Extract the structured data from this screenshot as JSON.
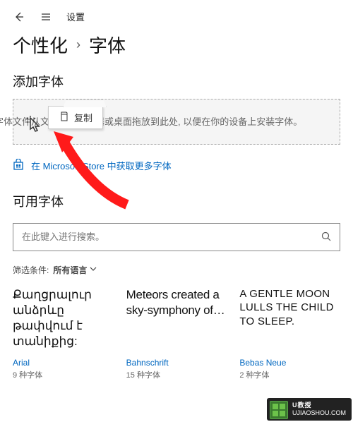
{
  "header": {
    "title": "设置"
  },
  "breadcrumb": {
    "parent": "个性化",
    "sep": "›",
    "current": "字体"
  },
  "add_fonts": {
    "title": "添加字体",
    "dropzone_text_full": "将字体文件从文件资源管理器或桌面拖放到此处, 以便在你的设备上安装字体。",
    "context_menu_item": "复制"
  },
  "store_link": "在 Microsoft Store 中获取更多字体",
  "available": {
    "title": "可用字体",
    "search_placeholder": "在此键入进行搜索。",
    "filter_label": "筛选条件:",
    "filter_value": "所有语言"
  },
  "fonts": [
    {
      "sample": "Քաղցրալուր անձրևը թափվում է տանիքից:",
      "name": "Arial",
      "count": "9 种字体"
    },
    {
      "sample": "Meteors created a sky-symphony of…",
      "name": "Bahnschrift",
      "count": "15 种字体"
    },
    {
      "sample": "A gentle moon lulls the child to sleep.",
      "name": "Bebas Neue",
      "count": "2 种字体"
    }
  ],
  "watermark": {
    "title": "U教授",
    "url": "UJIAOSHOU.COM"
  }
}
